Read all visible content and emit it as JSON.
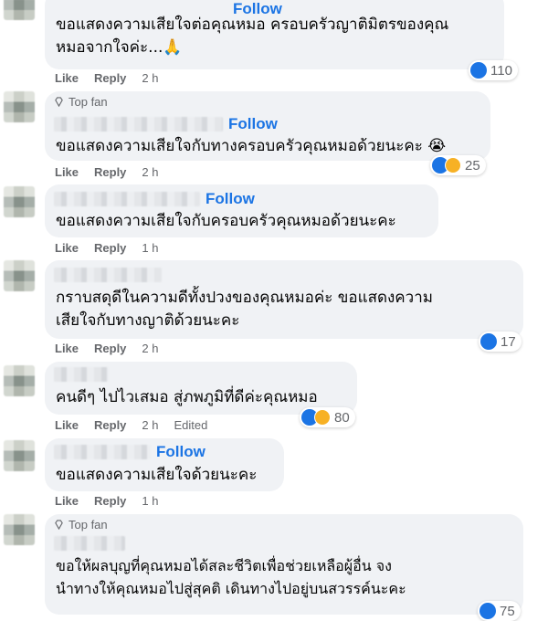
{
  "comments": [
    {
      "text_lines": [
        "ขอแสดงความเสียใจต่อคุณหมอ ครอบครัวญาติมิตรของคุณ",
        "หมอจากใจค่ะ...🙏"
      ],
      "follow": "Follow",
      "like": "Like",
      "reply": "Reply",
      "time": "2 h",
      "reactions": {
        "count": "110",
        "icons": [
          "like-icon"
        ]
      }
    },
    {
      "badge": "Top fan",
      "follow": "Follow",
      "text_lines": [
        "ขอแสดงความเสียใจกับทางครอบครัวคุณหมอด้วยนะคะ 😭"
      ],
      "like": "Like",
      "reply": "Reply",
      "time": "2 h",
      "reactions": {
        "count": "25",
        "icons": [
          "like-icon",
          "sad-icon"
        ]
      }
    },
    {
      "follow": "Follow",
      "text_lines": [
        "ขอแสดงความเสียใจกับครอบครัวคุณหมอด้วยนะคะ"
      ],
      "like": "Like",
      "reply": "Reply",
      "time": "1 h"
    },
    {
      "text_lines": [
        "กราบสดุดีในความดีทั้งปวงของคุณหมอค่ะ ขอแสดงความ",
        "เสียใจกับทางญาติด้วยนะคะ"
      ],
      "like": "Like",
      "reply": "Reply",
      "time": "2 h",
      "reactions": {
        "count": "17",
        "icons": [
          "like-icon"
        ]
      }
    },
    {
      "text_lines": [
        "คนดีๆ ไปไวเสมอ สู่ภพภูมิที่ดีค่ะคุณหมอ"
      ],
      "like": "Like",
      "reply": "Reply",
      "time": "2 h",
      "edited": "Edited",
      "reactions": {
        "count": "80",
        "icons": [
          "like-icon",
          "sad-icon"
        ]
      }
    },
    {
      "follow": "Follow",
      "text_lines": [
        "ขอแสดงความเสียใจด้วยนะคะ"
      ],
      "like": "Like",
      "reply": "Reply",
      "time": "1 h"
    },
    {
      "badge": "Top fan",
      "text_lines": [
        "ขอให้ผลบุญที่คุณหมอได้สละชีวิตเพื่อช่วยเหลือผู้อื่น จง",
        "นำทางให้คุณหมอไปสู่สุคติ เดินทางไปอยู่บนสวรรค์นะคะ"
      ],
      "reactions": {
        "count": "75",
        "icons": [
          "like-icon"
        ]
      }
    }
  ],
  "colors": {
    "bubble": "#f0f2f5",
    "link": "#1b74e4",
    "meta": "#65676b",
    "like": "#1b74e4",
    "sad": "#f7b125"
  }
}
